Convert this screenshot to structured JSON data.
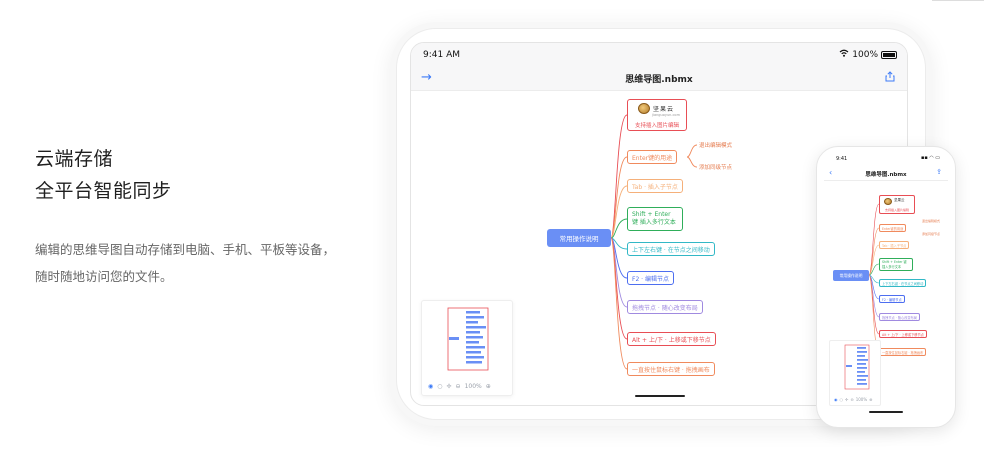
{
  "heading": {
    "line1": "云端存储",
    "line2": "全平台智能同步"
  },
  "description": "编辑的思维导图自动存储到电脑、手机、平板等设备，随时随地访问您的文件。",
  "tablet": {
    "status_time": "9:41 AM",
    "battery": "100%",
    "file_title": "思维导图.nbmx",
    "zoom": "100%"
  },
  "phone": {
    "status_time": "9:41",
    "file_title": "思维导图.nbmx",
    "zoom": "100%"
  },
  "mindmap": {
    "root": "常用操作说明",
    "logo_text": "坚果云",
    "logo_sub": "jianguoyun.com",
    "logo_caption": "支持插入图片编辑",
    "nodes": [
      {
        "label": "Enter键的用途",
        "color": "#f08a5d"
      },
      {
        "label": "Tab · 插入子节点",
        "color": "#f5b07a"
      },
      {
        "label": "Shift + Enter 键 插入多行文本",
        "color": "#2fae5a"
      },
      {
        "label": "上下左右键 · 在节点之间移动",
        "color": "#32b8c6"
      },
      {
        "label": "F2 · 编辑节点",
        "color": "#4d6ef0"
      },
      {
        "label": "拖拽节点 · 随心改变布局",
        "color": "#a08ae0"
      },
      {
        "label": "Alt + 上/下 · 上移或下移节点",
        "color": "#e84e55"
      },
      {
        "label": "一直按住鼠标右键 · 拖拽画布",
        "color": "#f08a5d"
      }
    ],
    "leaves": [
      {
        "label": "退出编辑模式"
      },
      {
        "label": "添加同级节点"
      }
    ]
  },
  "colors": {
    "accent": "#3d7bf7",
    "root": "#6a8ff5"
  }
}
